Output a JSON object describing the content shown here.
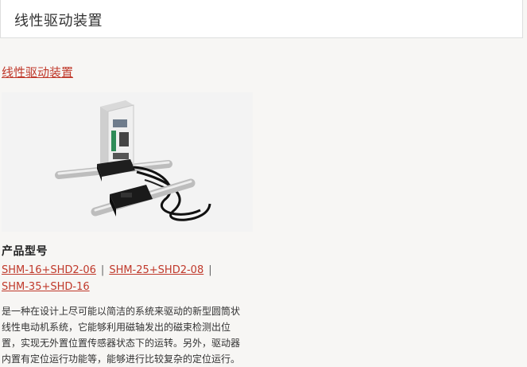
{
  "header": {
    "title": "线性驱动装置"
  },
  "main": {
    "section_link": "线性驱动装置",
    "product_image_alt": "线性驱动装置 产品图片",
    "models_heading": "产品型号",
    "models": [
      {
        "label": "SHM-16+SHD2-06"
      },
      {
        "label": "SHM-25+SHD2-08"
      },
      {
        "label": "SHM-35+SHD-16"
      }
    ],
    "separator": "|",
    "description": "是一种在设计上尽可能以简洁的系统来驱动的新型圆筒状线性电动机系统，它能够利用磁轴发出的磁束检测出位置，实现无外置位置传感器状态下的运转。另外，驱动器内置有定位运行功能等，能够进行比较复杂的定位运行。"
  },
  "colors": {
    "link": "#c0392b",
    "background": "#f7f6f4",
    "header_bg": "#ffffff"
  },
  "icons": {
    "product_photo": "linear-actuator-photo"
  }
}
